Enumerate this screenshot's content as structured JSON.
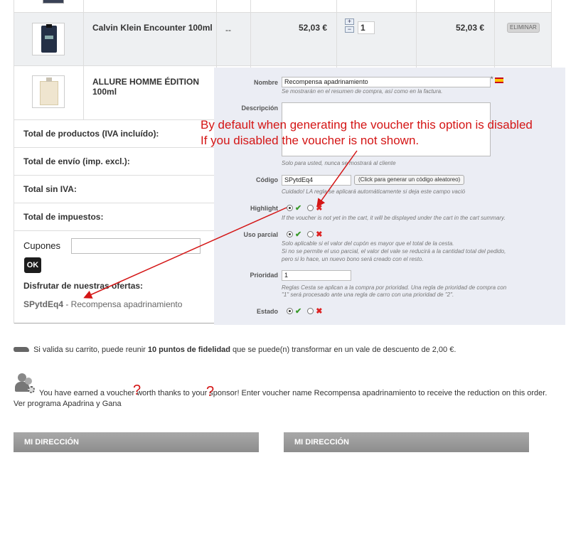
{
  "cart": {
    "products": [
      {
        "name": "Calvin Klein Encounter 100ml",
        "attributes": "--",
        "unit_price": "52,03 €",
        "quantity": "1",
        "total": "52,03 €",
        "remove_label": "ELIMINAR"
      },
      {
        "name": "ALLURE HOMME ÉDITION 100ml"
      }
    ],
    "qty_plus": "+",
    "qty_minus": "−",
    "totals": [
      "Total de productos (IVA incluído):",
      "Total de envío (imp. excl.):",
      "Total sin IVA:",
      "Total de impuestos:"
    ],
    "voucher": {
      "label": "Cupones",
      "value": "",
      "ok_label": "OK",
      "offers_title": "Disfrutar de nuestras ofertas:",
      "offer_code": "SPytdEq4",
      "offer_name": " - Recompensa apadrinamiento"
    }
  },
  "admin_form": {
    "nombre_label": "Nombre",
    "nombre_value": "Recompensa apadrinamiento",
    "nombre_hint": "Se mostrarán en el resumen de compra, así como en la factura.",
    "required_mark": "*",
    "descripcion_label": "Descripción",
    "descripcion_hint": "Solo para usted, nunca se mostrará al cliente",
    "codigo_label": "Código",
    "codigo_value": "SPytdEq4",
    "codigo_button": "(Click para generar un código aleatoreo)",
    "codigo_hint": "Cuidado! LA regla se aplicará automáticamente si deja este campo vació",
    "highlight_label": "Highlight",
    "highlight_hint": "If the voucher is not yet in the cart, it will be displayed under the cart in the cart summary.",
    "uso_parcial_label": "Uso parcial",
    "uso_parcial_hint": [
      "Solo aplicable si el valor del cupón es mayor que el total de la cesta.",
      "Si no se permite el uso parcial, el valor del vale se reducirá a la cantidad total del pedido,",
      "pero si lo hace, un nuevo bono será creado con el resto."
    ],
    "prioridad_label": "Prioridad",
    "prioridad_value": "1",
    "prioridad_hint": [
      "Reglas Cesta se aplican a la compra por prioridad. Una regla de prioridad de compra con",
      "\"1\" será procesado ante una regla de carro con una prioridad de \"2\"."
    ],
    "estado_label": "Estado",
    "check_icon": "✔",
    "cross_icon": "✖"
  },
  "annotation": {
    "line1": "By default when generating the voucher this option is disabled",
    "line2": "If you disabled the voucher is not shown.",
    "color": "#d41515"
  },
  "fidelity": {
    "before": "Si valida su carrito, puede reunir ",
    "points": "10 puntos de fidelidad",
    "after": " que se puede(n) transformar en un vale de descuento de 2,00 €."
  },
  "sponsor": {
    "text": "You have earned a voucher worth thanks to your sponsor! Enter voucher name Recompensa apadrinamiento to receive the reduction on this order.",
    "link": "Ver programa Apadrina y Gana",
    "qmark": "?"
  },
  "address": {
    "left_title": "MI DIRECCIÓN",
    "right_title": "MI DIRECCIÓN"
  }
}
